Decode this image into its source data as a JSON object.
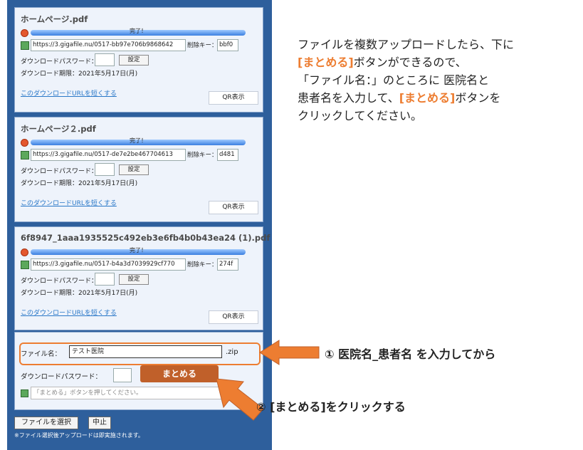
{
  "files": [
    {
      "name": "ホームページ.pdf",
      "progress_text": "完了！",
      "progress": 1.0,
      "url": "https://3.gigafile.nu/0517-bb97e706b9868642",
      "delete_label": "削除キー：",
      "delete_key": "bbf0",
      "password_label": "ダウンロードパスワード：",
      "set_label": "設定",
      "expire": "ダウンロード期限：2021年5月17日(月)",
      "short_link": "このダウンロードURLを短くする",
      "qr_label": "QR表示"
    },
    {
      "name": "ホームページ２.pdf",
      "progress_text": "完了！",
      "progress": 1.0,
      "url": "https://3.gigafile.nu/0517-de7e2be467704613",
      "delete_label": "削除キー：",
      "delete_key": "d481",
      "password_label": "ダウンロードパスワード：",
      "set_label": "設定",
      "expire": "ダウンロード期限：2021年5月17日(月)",
      "short_link": "このダウンロードURLを短くする",
      "qr_label": "QR表示"
    },
    {
      "name": "6f8947_1aaa1935525c492eb3e6fb4b0b43ea24 (1).pdf",
      "progress_text": "完了！",
      "progress": 1.0,
      "url": "https://3.gigafile.nu/0517-b4a3d7039929cf770",
      "delete_label": "削除キー：",
      "delete_key": "274f",
      "password_label": "ダウンロードパスワード：",
      "set_label": "設定",
      "expire": "ダウンロード期限：2021年5月17日(月)",
      "short_link": "このダウンロードURLを短くする",
      "qr_label": "QR表示"
    }
  ],
  "bundle": {
    "filename_label": "ファイル名：",
    "filename_value": "テスト医院",
    "ext": ".zip",
    "password_label": "ダウンロードパスワード：",
    "button": "まとめる",
    "message_placeholder": "「まとめる」ボタンを押してください。"
  },
  "footer": {
    "select_button": "ファイルを選択",
    "stop_button": "中止",
    "note": "※ファイル選択後アップロードは即実施されます。"
  },
  "instructions": {
    "line1": "ファイルを複数アップロードしたら、下に",
    "line2_hl": "[まとめる]",
    "line2_rest": "ボタンができるので、",
    "line3": "「ファイル名：」のところに 医院名と",
    "line4_a": "患者名を入力して、",
    "line4_hl": "[まとめる]",
    "line4_b": "ボタンを",
    "line5": "クリックしてください。"
  },
  "callouts": {
    "step1": "① 医院名_患者名 を入力してから",
    "step2": "② [まとめる]をクリックする"
  },
  "colors": {
    "panel": "#2e5f9c",
    "accent": "#ed7d31",
    "button": "#c0602a"
  }
}
